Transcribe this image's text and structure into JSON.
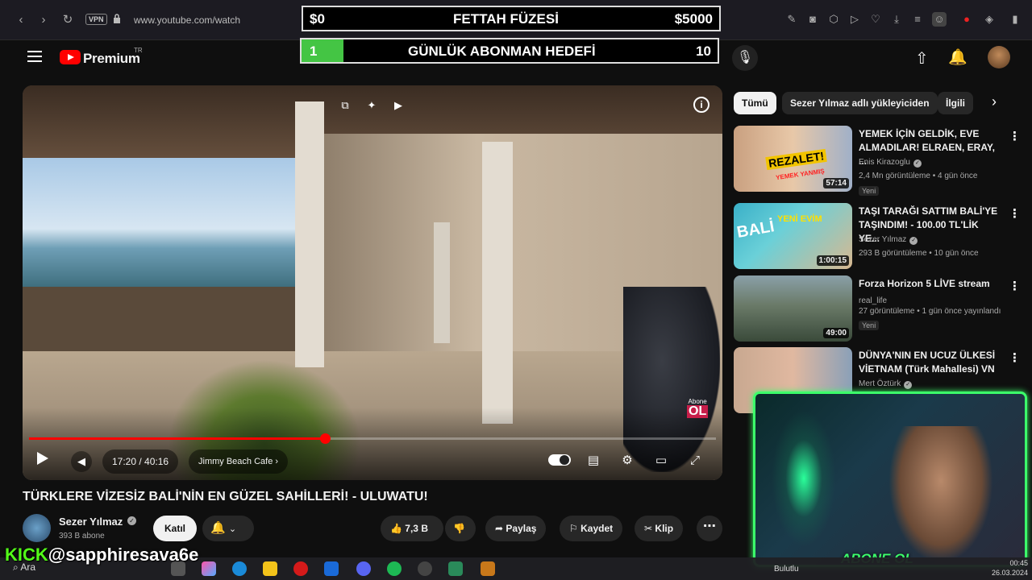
{
  "browser": {
    "url": "www.youtube.com/watch",
    "vpn_label": "VPN"
  },
  "overlay_top": {
    "left": "$0",
    "center": "FETTAH FÜZESİ",
    "right": "$5000"
  },
  "overlay_goal": {
    "left": "1",
    "center": "GÜNLÜK ABONMAN HEDEFİ",
    "right": "10",
    "progress_fraction": 0.1
  },
  "youtube": {
    "premium": "Premium",
    "region": "TR"
  },
  "player": {
    "time": "17:20 / 40:16",
    "chapter": "Jimmy Beach Cafe",
    "progress_fraction": 0.4306,
    "abone_small": "Abone",
    "abone_big": "OL"
  },
  "video": {
    "title": "TÜRKLERE VİZESİZ BALİ'NİN EN GÜZEL SAHİLLERİ! - ULUWATU!",
    "channel": "Sezer Yılmaz",
    "subscribers": "393 B abone",
    "join": "Katıl",
    "likes": "7,3 B",
    "share": "Paylaş",
    "save": "Kaydet",
    "clip": "Klip"
  },
  "chips": [
    "Tümü",
    "Sezer Yılmaz adlı yükleyiciden",
    "İlgili"
  ],
  "recommendations": [
    {
      "title": "YEMEK İÇİN GELDİK, EVE ALMADILAR! ELRAEN, ERAY, ...",
      "channel": "Enis Kirazoglu",
      "meta": "2,4 Mn görüntüleme • 4 gün önce",
      "badge": "Yeni",
      "duration": "57:14",
      "thumb_text": "REZALET!",
      "thumb_sub": "YEMEK YANMIŞ"
    },
    {
      "title": "TAŞI TARAĞI SATTIM BALİ'YE TAŞINDIM! - 100.00 TL'LİK YE...",
      "channel": "Sezer Yılmaz",
      "meta": "293 B görüntüleme • 10 gün önce",
      "badge": "",
      "duration": "1:00:15",
      "thumb_text": "BALİ",
      "thumb_sub": "YENİ EVİM"
    },
    {
      "title": "Forza Horizon 5 LİVE stream",
      "channel": "real_life",
      "meta": "27 görüntüleme • 1 gün önce yayınlandı",
      "badge": "Yeni",
      "duration": "49:00",
      "thumb_text": "",
      "thumb_sub": ""
    },
    {
      "title": "DÜNYA'NIN EN UCUZ ÜLKESİ VİETNAM (Türk Mahallesi) VN",
      "channel": "Mert Öztürk",
      "meta": "",
      "badge": "",
      "duration": "",
      "thumb_text": "",
      "thumb_sub": ""
    }
  ],
  "stream": {
    "kick": "KICK",
    "handle": "@sapphiresava6e",
    "abone_ol": "ABONE OL"
  },
  "taskbar": {
    "search": "Ara",
    "weather": "Bulutlu",
    "time": "00:45",
    "date": "26.03.2024"
  }
}
